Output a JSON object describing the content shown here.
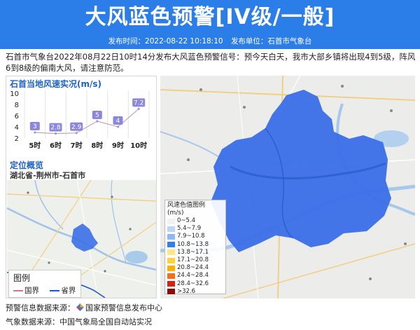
{
  "header": {
    "title": "大风蓝色预警[IV级/一般]",
    "publish_time_label": "发布时间：2022-08-22 10:18:10",
    "publisher_label": "发布单位：石首市气象台"
  },
  "description": "石首市气象台2022年08月22日10时14分发布大风蓝色预警信号：预今天白天，我市大部乡镇将出现4到5级，阵风6到8级的偏南大风，请注意防范。",
  "wind_section": {
    "title": "石首当地风速实况(m/s)"
  },
  "chart_data": {
    "type": "line",
    "title": "石首当地风速实况(m/s)",
    "categories": [
      "5时",
      "6时",
      "7时",
      "8时",
      "9时",
      "10时"
    ],
    "series": [
      {
        "values": [
          3,
          2.8,
          2.9,
          5,
          4,
          7.2
        ]
      }
    ],
    "data_labels": [
      "3",
      "2.8",
      "2.9",
      "5",
      "4",
      "7.2"
    ],
    "yticks": [
      "2",
      "4",
      "6",
      "8",
      "10"
    ],
    "ylim": [
      2,
      10
    ],
    "colors": {
      "line": "#c9a5ad",
      "label_bg": "#8b87dd",
      "grid": "#e3e3e3"
    }
  },
  "location": {
    "title": "定位概览",
    "subtitle": "湖北省-荆州市-石首市"
  },
  "map_legend": {
    "title": "图例",
    "country_border": "国界",
    "province_border": "省界",
    "colors": {
      "country": "#cc7a8a",
      "province": "#1f57c9"
    }
  },
  "color_legend": {
    "title": "风速色值图例 (m/s)",
    "items": [
      {
        "label": "0~5.4",
        "color": "#f2f2f2"
      },
      {
        "label": "5.4~7.9",
        "color": "#bcd7f2"
      },
      {
        "label": "7.9~10.8",
        "color": "#8cbaf0"
      },
      {
        "label": "10.8~13.8",
        "color": "#2f7ff0"
      },
      {
        "label": "13.8~17.1",
        "color": "#ffe68a"
      },
      {
        "label": "17.1~20.8",
        "color": "#ffd23f"
      },
      {
        "label": "20.8~24.4",
        "color": "#ffb000"
      },
      {
        "label": "24.4~28.4",
        "color": "#f07020"
      },
      {
        "label": "28.4~32.6",
        "color": "#d62010"
      },
      {
        "label": ">32.6",
        "color": "#8b0a0a"
      }
    ]
  },
  "footer": {
    "warning_source": "预警信息数据来源：",
    "warning_source_org": "国家预警信息发布中心",
    "weather_source": "气象数据来源：中国气象局全国自动站实况"
  },
  "colors": {
    "banner": "#2b7ee8",
    "accent": "#1e62c8",
    "warning_area": "#3a6fe8"
  }
}
